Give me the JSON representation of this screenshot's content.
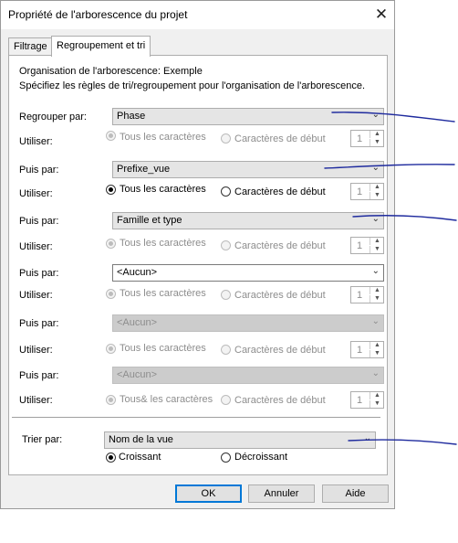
{
  "window": {
    "title": "Propriété de l'arborescence du projet"
  },
  "tabs": [
    {
      "label": "Filtrage"
    },
    {
      "label": "Regroupement et tri"
    }
  ],
  "intro": {
    "line1": "Organisation de l'arborescence: Exemple",
    "line2": "Spécifiez les règles de tri/regroupement pour l'organisation de l'arborescence."
  },
  "rows": [
    {
      "label": "Regrouper par:",
      "value": "Phase",
      "use_label": "Utiliser:",
      "opt_all": "Tous les caractères",
      "opt_start": "Caractères de début",
      "count": "1"
    },
    {
      "label": "Puis par:",
      "value": "Prefixe_vue",
      "use_label": "Utiliser:",
      "opt_all": "Tous les caractères",
      "opt_start": "Caractères de début",
      "count": "1"
    },
    {
      "label": "Puis par:",
      "value": "Famille et type",
      "use_label": "Utiliser:",
      "opt_all": "Tous les caractères",
      "opt_start": "Caractères de début",
      "count": "1"
    },
    {
      "label": "Puis par:",
      "value": "<Aucun>",
      "use_label": "Utiliser:",
      "opt_all": "Tous les caractères",
      "opt_start": "Caractères de début",
      "count": "1"
    },
    {
      "label": "Puis par:",
      "value": "<Aucun>",
      "use_label": "Utiliser:",
      "opt_all": "Tous les caractères",
      "opt_start": "Caractères de début",
      "count": "1"
    },
    {
      "label": "Puis par:",
      "value": "<Aucun>",
      "use_label": "Utiliser:",
      "opt_all": "Tous& les caractères",
      "opt_start": "Caractères de début",
      "count": "1"
    }
  ],
  "sort": {
    "label": "Trier par:",
    "value": "Nom de la vue",
    "asc": "Croissant",
    "desc": "Décroissant"
  },
  "buttons": {
    "ok": "OK",
    "cancel": "Annuler",
    "help": "Aide"
  },
  "icons": {
    "close": "close-icon",
    "dropdown": "chevron-down-icon",
    "spin_up": "spin-up-icon",
    "spin_down": "spin-down-icon"
  },
  "colors": {
    "default_button_border": "#0078d7",
    "annotation_ink": "#1f2b9e"
  }
}
